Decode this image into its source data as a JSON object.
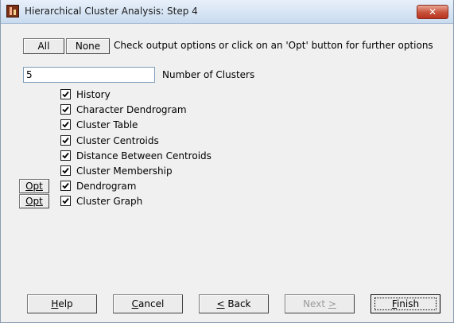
{
  "window": {
    "title": "Hierarchical Cluster Analysis: Step 4",
    "close_label": "✕"
  },
  "toolbar": {
    "all_label": "All",
    "none_label": "None",
    "instructions": "Check output options or click on an 'Opt' button for further options"
  },
  "clusters": {
    "value": "5",
    "label": "Number of Clusters"
  },
  "options": [
    {
      "label": "History",
      "checked": true,
      "has_opt": false
    },
    {
      "label": "Character Dendrogram",
      "checked": true,
      "has_opt": false
    },
    {
      "label": "Cluster Table",
      "checked": true,
      "has_opt": false
    },
    {
      "label": "Cluster Centroids",
      "checked": true,
      "has_opt": false
    },
    {
      "label": "Distance Between Centroids",
      "checked": true,
      "has_opt": false
    },
    {
      "label": "Cluster Membership",
      "checked": true,
      "has_opt": false
    },
    {
      "label": "Dendrogram",
      "checked": true,
      "has_opt": true
    },
    {
      "label": "Cluster Graph",
      "checked": true,
      "has_opt": true
    }
  ],
  "opt_label": "Opt",
  "buttons": {
    "help": {
      "pre": "",
      "key": "H",
      "post": "elp"
    },
    "cancel": {
      "pre": "",
      "key": "C",
      "post": "ancel"
    },
    "back": {
      "pre": "",
      "key": "<",
      "post": " Back"
    },
    "next": {
      "pre": "Next ",
      "key": ">",
      "post": ""
    },
    "finish": {
      "pre": "",
      "key": "F",
      "post": "inish"
    }
  },
  "colors": {
    "titlebar": "#c9dbef",
    "close": "#c7513a",
    "dialog_bg": "#f0f0f0"
  }
}
